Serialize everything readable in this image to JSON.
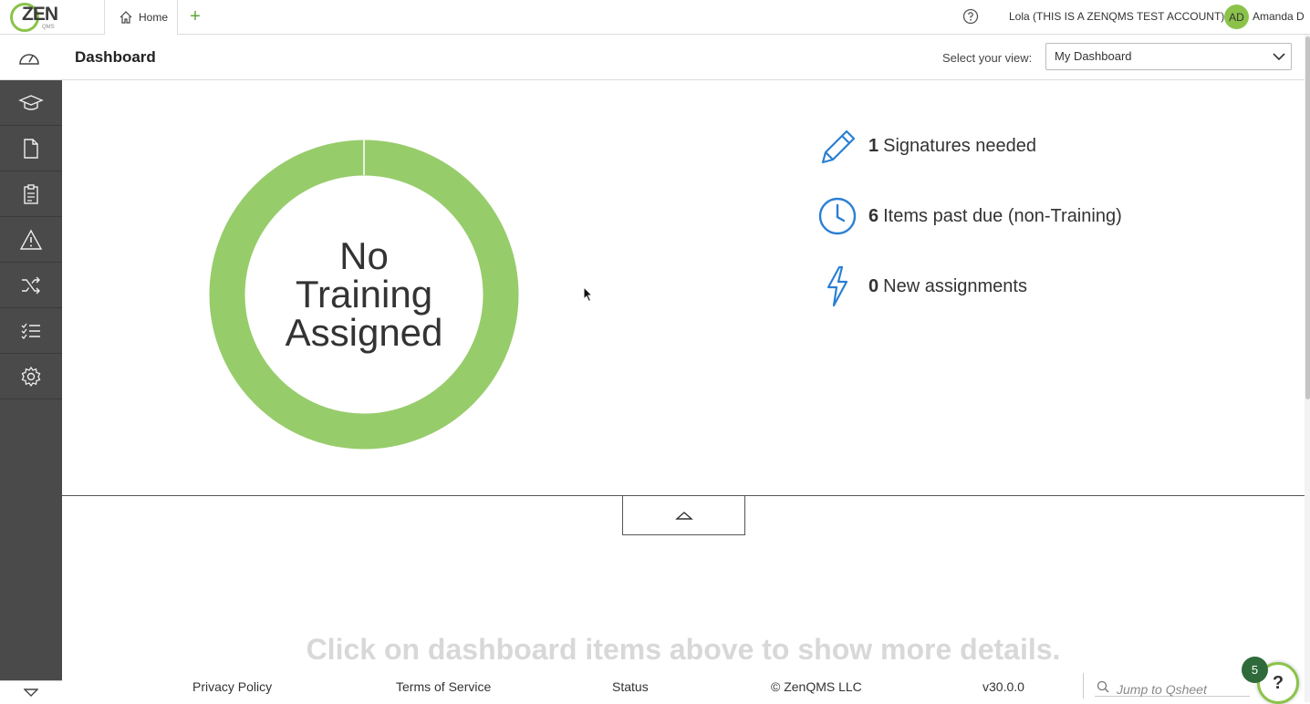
{
  "app": {
    "logo_text": "ZEN",
    "logo_sub": "QMS"
  },
  "topbar": {
    "home_tab_label": "Home",
    "add_tab_label": "+",
    "account_label": "Lola (THIS IS A ZENQMS TEST ACCOUNT)",
    "avatar_initials": "AD",
    "user_name": "Amanda D"
  },
  "subheader": {
    "title": "Dashboard",
    "view_label": "Select your view:",
    "view_selected": "My Dashboard"
  },
  "sidebar": {
    "items": [
      {
        "name": "training",
        "icon": "graduation-cap-icon"
      },
      {
        "name": "documents",
        "icon": "document-icon"
      },
      {
        "name": "audits",
        "icon": "clipboard-icon"
      },
      {
        "name": "events",
        "icon": "warning-icon"
      },
      {
        "name": "changes",
        "icon": "shuffle-icon"
      },
      {
        "name": "tasks",
        "icon": "checklist-icon"
      },
      {
        "name": "settings",
        "icon": "gear-icon"
      }
    ]
  },
  "training_chart": {
    "center_label": "No Training Assigned",
    "ring_color": "#97cc6b"
  },
  "stats": [
    {
      "count": "1",
      "label": "Signatures needed",
      "icon": "pencil-icon"
    },
    {
      "count": "6",
      "label": "Items past due (non-Training)",
      "icon": "clock-icon"
    },
    {
      "count": "0",
      "label": "New assignments",
      "icon": "lightning-icon"
    }
  ],
  "details_hint": "Click on dashboard items above to show more details.",
  "footer": {
    "privacy": "Privacy Policy",
    "terms": "Terms of Service",
    "status": "Status",
    "copyright": "© ZenQMS LLC",
    "version": "v30.0.0",
    "search_placeholder": "Jump to Qsheet"
  },
  "help_widget": {
    "badge_count": "5",
    "label": "?"
  },
  "colors": {
    "accent_green": "#8bc34a",
    "icon_blue": "#2a7fd4",
    "sidebar_bg": "#4a4a4a"
  }
}
